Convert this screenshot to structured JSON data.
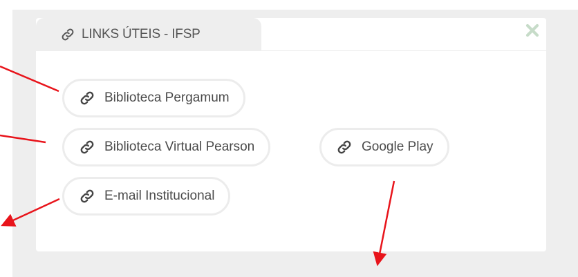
{
  "panel": {
    "title": "LINKS ÚTEIS - IFSP",
    "title_icon": "link-icon",
    "close_icon": "close-icon"
  },
  "links": [
    {
      "label": "Biblioteca Pergamum",
      "icon": "link-icon"
    },
    {
      "label": "Biblioteca Virtual Pearson",
      "icon": "link-icon"
    },
    {
      "label": "Google Play",
      "icon": "link-icon"
    },
    {
      "label": "E-mail Institucional",
      "icon": "link-icon"
    }
  ],
  "colors": {
    "backdrop": "#eeeeee",
    "card": "#ffffff",
    "text": "#4a4a4a",
    "close": "#c7dcc9",
    "annotation_arrow": "#e8141b"
  }
}
